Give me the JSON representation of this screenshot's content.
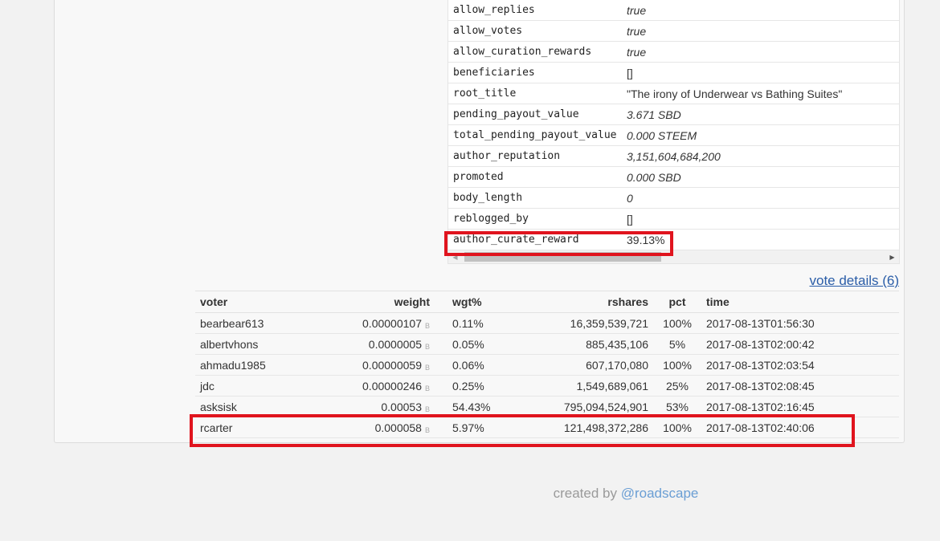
{
  "properties": [
    {
      "key": "allow_replies",
      "value": "true",
      "italic": true
    },
    {
      "key": "allow_votes",
      "value": "true",
      "italic": true
    },
    {
      "key": "allow_curation_rewards",
      "value": "true",
      "italic": true
    },
    {
      "key": "beneficiaries",
      "value": "[]",
      "italic": false
    },
    {
      "key": "root_title",
      "value": "\"The irony of Underwear vs Bathing Suites\"",
      "italic": false
    },
    {
      "key": "pending_payout_value",
      "value": "3.671 SBD",
      "italic": true
    },
    {
      "key": "total_pending_payout_value",
      "value": "0.000 STEEM",
      "italic": true
    },
    {
      "key": "author_reputation",
      "value": "3,151,604,684,200",
      "italic": true
    },
    {
      "key": "promoted",
      "value": "0.000 SBD",
      "italic": true
    },
    {
      "key": "body_length",
      "value": "0",
      "italic": true
    },
    {
      "key": "reblogged_by",
      "value": "[]",
      "italic": false
    },
    {
      "key": "author_curate_reward",
      "value": "39.13%",
      "italic": false
    }
  ],
  "vote_details_link": "vote details (6)",
  "votes": {
    "headers": {
      "voter": "voter",
      "weight": "weight",
      "wgt": "wgt%",
      "rshares": "rshares",
      "pct": "pct",
      "time": "time"
    },
    "unit_symbol": "B",
    "rows": [
      {
        "voter": "bearbear613",
        "weight": "0.00000107",
        "wgt": "0.11%",
        "rshares": "16,359,539,721",
        "pct": "100%",
        "time": "2017-08-13T01:56:30"
      },
      {
        "voter": "albertvhons",
        "weight": "0.0000005",
        "wgt": "0.05%",
        "rshares": "885,435,106",
        "pct": "5%",
        "time": "2017-08-13T02:00:42"
      },
      {
        "voter": "ahmadu1985",
        "weight": "0.00000059",
        "wgt": "0.06%",
        "rshares": "607,170,080",
        "pct": "100%",
        "time": "2017-08-13T02:03:54"
      },
      {
        "voter": "jdc",
        "weight": "0.00000246",
        "wgt": "0.25%",
        "rshares": "1,549,689,061",
        "pct": "25%",
        "time": "2017-08-13T02:08:45"
      },
      {
        "voter": "asksisk",
        "weight": "0.00053",
        "wgt": "54.43%",
        "rshares": "795,094,524,901",
        "pct": "53%",
        "time": "2017-08-13T02:16:45"
      },
      {
        "voter": "rcarter",
        "weight": "0.000058",
        "wgt": "5.97%",
        "rshares": "121,498,372,286",
        "pct": "100%",
        "time": "2017-08-13T02:40:06"
      }
    ]
  },
  "footer": {
    "prefix": "created by ",
    "link": "@roadscape"
  },
  "colors": {
    "highlight": "#e0141e",
    "link": "#2a5da8",
    "footer_link": "#6a9ed4"
  }
}
